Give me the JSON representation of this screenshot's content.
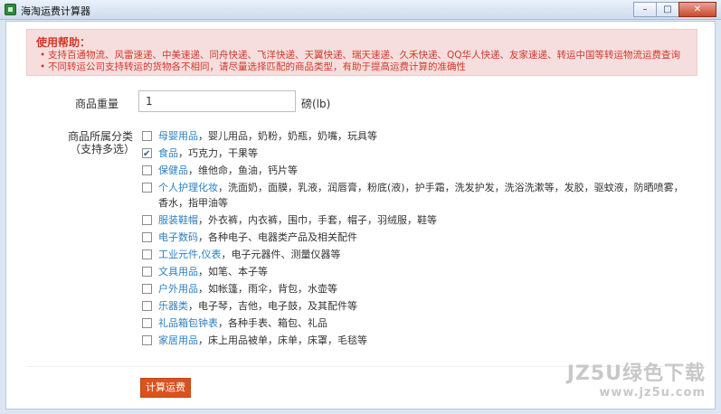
{
  "window": {
    "title": "海淘运费计算器",
    "min": "–",
    "max": "□",
    "close": "✕"
  },
  "help": {
    "title": "使用帮助：",
    "items": [
      "支持百通物流、风雷速递、中美速递、同舟快递、飞洋快递、天翼快递、瑞天速递、久禾快递、QQ华人快递、友家速递、转运中国等转运物流运费查询",
      "不同转运公司支持转运的货物各不相同，请尽量选择匹配的商品类型，有助于提高运费计算的准确性"
    ]
  },
  "form": {
    "weight_label": "商品重量",
    "weight_value": "1",
    "weight_unit": "磅(lb)",
    "category_label_line1": "商品所属分类",
    "category_label_line2": "（支持多选）"
  },
  "categories": [
    {
      "name": "母婴用品",
      "desc": "，婴儿用品，奶粉，奶瓶，奶嘴，玩具等",
      "checked": false
    },
    {
      "name": "食品",
      "desc": "，巧克力，干果等",
      "checked": true
    },
    {
      "name": "保健品",
      "desc": "，维他命，鱼油，钙片等",
      "checked": false
    },
    {
      "name": "个人护理化妆",
      "desc": "，洗面奶，面膜，乳液，润唇膏，粉底(液)，护手霜，洗发护发，洗浴洗漱等，发胶，驱蚊液，防晒喷雾，香水，指甲油等",
      "checked": false
    },
    {
      "name": "服装鞋帽",
      "desc": "，外衣裤，内衣裤，围巾，手套，帽子，羽绒服，鞋等",
      "checked": false
    },
    {
      "name": "电子数码",
      "desc": "，各种电子、电器类产品及相关配件",
      "checked": false
    },
    {
      "name": "工业元件,仪表",
      "desc": "，电子元器件、测量仪器等",
      "checked": false
    },
    {
      "name": "文具用品",
      "desc": "，如笔、本子等",
      "checked": false
    },
    {
      "name": "户外用品",
      "desc": "，如帐篷，雨伞，背包，水壶等",
      "checked": false
    },
    {
      "name": "乐器类",
      "desc": "，电子琴，吉他，电子鼓，及其配件等",
      "checked": false
    },
    {
      "name": "礼品箱包钟表",
      "desc": "，各种手表、箱包、礼品",
      "checked": false
    },
    {
      "name": "家居用品",
      "desc": "，床上用品被单，床单，床罩，毛毯等",
      "checked": false
    }
  ],
  "actions": {
    "calculate_label": "计算运费"
  },
  "watermark": {
    "line1": "JZ5U绿色下载",
    "line2": "www.jz5u.com"
  },
  "colors": {
    "accent": "#d9531e",
    "link": "#2b7fc1",
    "help_bg": "#f6dede",
    "help_text": "#d03a2a"
  }
}
